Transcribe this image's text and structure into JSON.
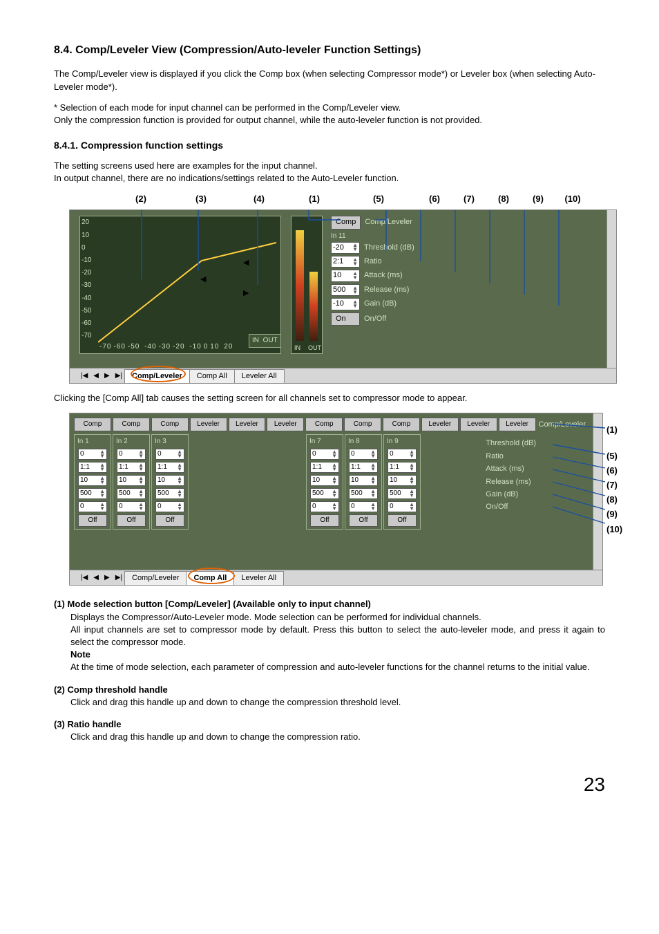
{
  "heading": "8.4. Comp/Leveler View (Compression/Auto-leveler Function Settings)",
  "intro": "The Comp/Leveler view is displayed if you click the Comp box (when selecting Compressor mode*) or Leveler box (when selecting Auto-Leveler mode*).",
  "footnote": "*  Selection of each mode for input channel can be performed in the Comp/Leveler view.\n    Only the compression function is provided for output channel, while the auto-leveler function is not provided.",
  "sub1": "8.4.1. Compression function settings",
  "sub1_p1": "The setting screens used here are examples for the input channel.",
  "sub1_p2": "In output channel, there are no indications/settings related to the Auto-Leveler function.",
  "callouts_top": [
    "(2)",
    "(3)",
    "(4)",
    "(1)",
    "(5)",
    "(6)",
    "(7)",
    "(8)",
    "(9)",
    "(10)"
  ],
  "shot1": {
    "yticks": [
      "20",
      "10",
      "0",
      "-10",
      "-20",
      "-30",
      "-40",
      "-50",
      "-60",
      "-70"
    ],
    "xticks": [
      "-70",
      "-60",
      "-50",
      "-40",
      "-30",
      "-20",
      "-10",
      "0",
      "10",
      "20"
    ],
    "inout": {
      "in": "IN",
      "out": "OUT"
    },
    "panel_button": "Comp",
    "panel_mode": "Comp/Leveler",
    "panel_group": "In 11",
    "rows": [
      {
        "val": "-20",
        "label": "Threshold (dB)"
      },
      {
        "val": "2:1",
        "label": "Ratio"
      },
      {
        "val": "10",
        "label": "Attack (ms)"
      },
      {
        "val": "500",
        "label": "Release (ms)"
      },
      {
        "val": "-10",
        "label": "Gain (dB)"
      },
      {
        "val": "On",
        "label": "On/Off"
      }
    ],
    "tabs": {
      "t1": "Comp/Leveler",
      "t2": "Comp All",
      "t3": "Leveler All"
    }
  },
  "after_shot1": "Clicking the [Comp All] tab causes the setting screen for all channels set to compressor mode to appear.",
  "shot2": {
    "header_buttons": [
      "Comp",
      "Comp",
      "Comp",
      "Leveler",
      "Leveler",
      "Leveler",
      "Comp",
      "Comp",
      "Comp",
      "Leveler",
      "Leveler",
      "Leveler",
      "Comp/Leveler"
    ],
    "col_titles": [
      "In 1",
      "In 2",
      "In 3",
      "",
      "",
      "",
      "In 7",
      "In 8",
      "In 9"
    ],
    "rows_labels": [
      "Threshold (dB)",
      "Ratio",
      "Attack (ms)",
      "Release (ms)",
      "Gain (dB)",
      "On/Off"
    ],
    "col_values": [
      "0",
      "1:1",
      "10",
      "500",
      "0",
      "Off"
    ],
    "tabs": {
      "t1": "Comp/Leveler",
      "t2": "Comp All",
      "t3": "Leveler All"
    },
    "right_callouts": [
      "(1)",
      "(5)",
      "(6)",
      "(7)",
      "(8)",
      "(9)",
      "(10)"
    ]
  },
  "desc": {
    "i1": {
      "t": "(1) Mode selection button [Comp/Leveler] (Available only to input channel)",
      "b1": "Displays the Compressor/Auto-Leveler mode. Mode selection can be performed for individual channels.",
      "b2": "All input channels are set to compressor mode by default. Press this button to select the auto-leveler mode, and press it again to select the compressor mode.",
      "note": "Note",
      "b3": "At the time of mode selection, each parameter of compression and auto-leveler functions for the channel returns to the initial value."
    },
    "i2": {
      "t": "(2) Comp threshold handle",
      "b": "Click and drag this handle up and down to change the compression threshold level."
    },
    "i3": {
      "t": "(3) Ratio handle",
      "b": "Click and drag this handle up and down to change the compression ratio."
    }
  },
  "pagenum": "23"
}
